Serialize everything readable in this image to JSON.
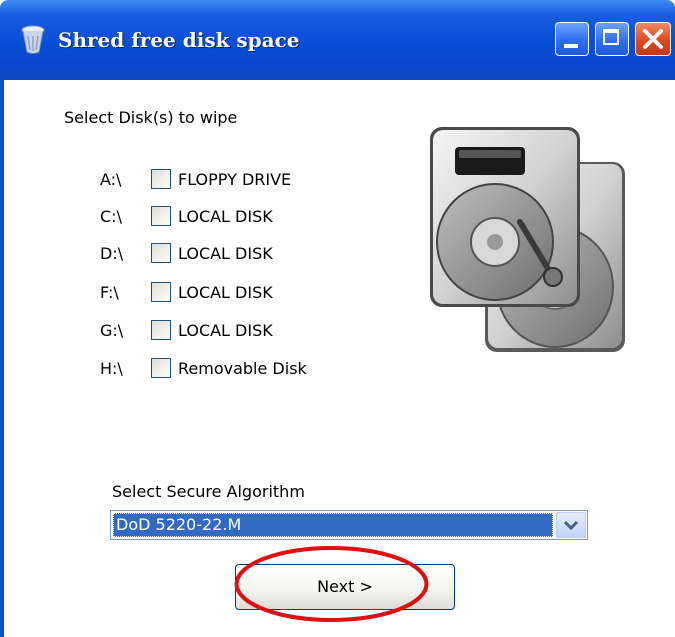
{
  "window": {
    "title": "Shred free disk space",
    "colors": {
      "titlebar": "#0a4fd8",
      "close_button": "#e04a1c",
      "selection": "#316ac5",
      "highlight_ring": "#e01010"
    },
    "icons": [
      "shredder-app-icon",
      "minimize-icon",
      "maximize-icon",
      "close-icon"
    ]
  },
  "disks": {
    "label": "Select Disk(s) to wipe",
    "items": [
      {
        "letter": "A:\\",
        "name": "FLOPPY DRIVE",
        "checked": false
      },
      {
        "letter": "C:\\",
        "name": "LOCAL DISK",
        "checked": false
      },
      {
        "letter": "D:\\",
        "name": "LOCAL DISK",
        "checked": false
      },
      {
        "letter": "F:\\",
        "name": "LOCAL DISK",
        "checked": false
      },
      {
        "letter": "G:\\",
        "name": "LOCAL DISK",
        "checked": false
      },
      {
        "letter": "H:\\",
        "name": "Removable Disk",
        "checked": false
      }
    ]
  },
  "algorithm": {
    "label": "Select Secure Algorithm",
    "selected": "DoD 5220-22.M"
  },
  "buttons": {
    "next": "Next >"
  }
}
